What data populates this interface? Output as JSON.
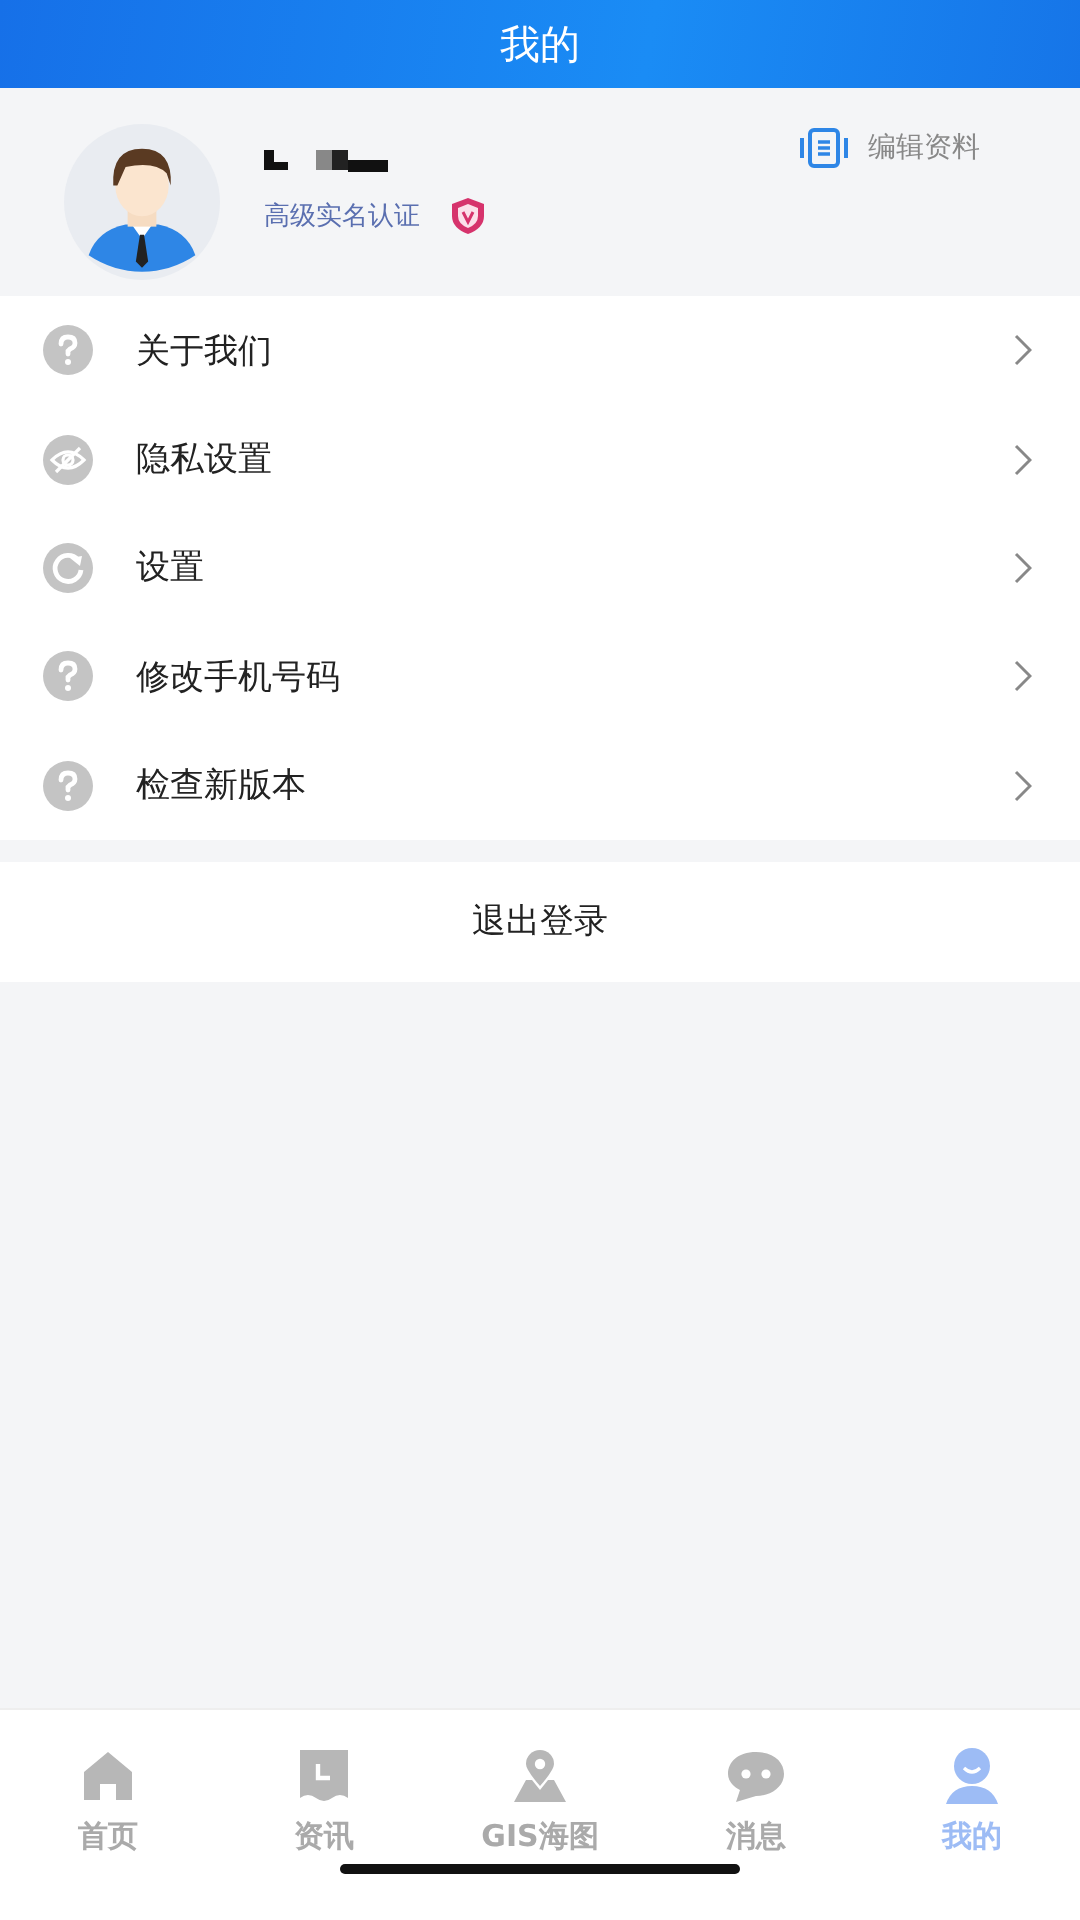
{
  "header": {
    "title": "我的"
  },
  "profile": {
    "verification": "高级实名认证",
    "edit_label": "编辑资料"
  },
  "menu": [
    {
      "label": "关于我们",
      "kind": "question"
    },
    {
      "label": "隐私设置",
      "kind": "eye"
    },
    {
      "label": "设置",
      "kind": "refresh"
    },
    {
      "label": "修改手机号码",
      "kind": "question"
    },
    {
      "label": "检查新版本",
      "kind": "question"
    }
  ],
  "logout": "退出登录",
  "tabs": [
    {
      "label": "首页",
      "kind": "home",
      "selected": false
    },
    {
      "label": "资讯",
      "kind": "news",
      "selected": false
    },
    {
      "label": "GIS海图",
      "kind": "map",
      "selected": false
    },
    {
      "label": "消息",
      "kind": "chat",
      "selected": false
    },
    {
      "label": "我的",
      "kind": "user",
      "selected": true
    }
  ]
}
